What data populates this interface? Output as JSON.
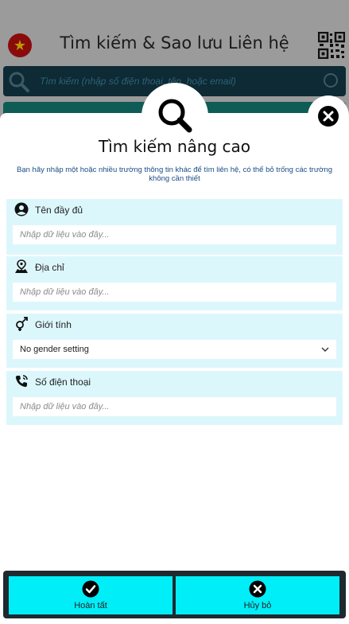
{
  "app": {
    "title": "Tìm kiếm & Sao lưu Liên hệ",
    "search_placeholder": "Tìm kiếm (nhập số điện thoại, tên, hoặc email)"
  },
  "modal": {
    "title": "Tìm kiếm nâng cao",
    "description": "Bạn hãy nhập một hoặc nhiều trường thông tin khác để tìm liên hệ, có thể bỏ trống các trường không cần thiết",
    "fields": [
      {
        "label": "Tên đầy đủ",
        "placeholder": "Nhập dữ liệu vào đây...",
        "icon": "person-icon"
      },
      {
        "label": "Địa chỉ",
        "placeholder": "Nhập dữ liệu vào đây...",
        "icon": "map-pin-icon"
      },
      {
        "label": "Giới tính",
        "selected": "No gender setting",
        "icon": "gender-icon"
      },
      {
        "label": "Số điện thoại",
        "placeholder": "Nhập dữ liệu vào đây...",
        "icon": "phone-icon"
      }
    ],
    "confirm_label": "Hoàn tất",
    "cancel_label": "Hủy bỏ"
  },
  "colors": {
    "accent": "#00eef8",
    "field_bg": "#dcf7fb",
    "footer_bg": "#1f2a30",
    "overlay": "#9a9a9a"
  }
}
